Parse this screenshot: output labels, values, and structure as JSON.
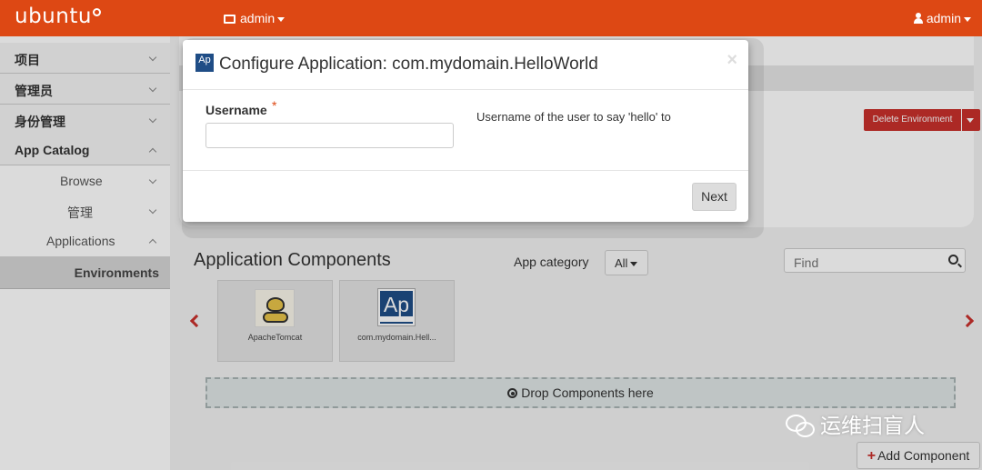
{
  "navbar": {
    "logo_text": "ubuntu",
    "project_menu": "admin",
    "user_menu": "admin",
    "color": "#dd4814"
  },
  "sidebar": {
    "items": [
      {
        "label": "项目",
        "state": "collapsed"
      },
      {
        "label": "管理员",
        "state": "collapsed"
      },
      {
        "label": "身份管理",
        "state": "collapsed"
      },
      {
        "label": "App Catalog",
        "state": "expanded"
      }
    ],
    "sub_items": [
      {
        "label": "Browse",
        "state": "collapsed"
      },
      {
        "label": "管理",
        "state": "collapsed"
      },
      {
        "label": "Applications",
        "state": "expanded"
      }
    ],
    "active_item": "Environments"
  },
  "page": {
    "delete_button": "Delete Environment",
    "components_title": "Application Components",
    "app_category_label": "App category",
    "category_value": "All",
    "find_placeholder": "Find",
    "drop_zone_text": "Drop Components here",
    "add_component_button": "Add Component",
    "tiles": [
      {
        "name": "ApacheTomcat",
        "icon": "tomcat-logo"
      },
      {
        "name": "com.mydomain.Hell...",
        "icon": "ap-application-logo",
        "icon_text": "Ap"
      }
    ]
  },
  "modal": {
    "title": "Configure Application: com.mydomain.HelloWorld",
    "logo_text": "Ap",
    "close_symbol": "×",
    "field_label": "Username",
    "required_mark": "*",
    "field_value": "",
    "help_text": "Username of the user to say 'hello' to",
    "next_button": "Next"
  },
  "watermark": {
    "text": "运维扫盲人"
  }
}
